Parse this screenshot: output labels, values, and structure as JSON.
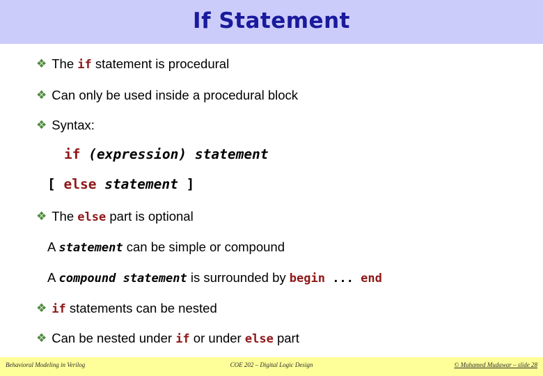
{
  "slide": {
    "title": "If Statement",
    "bullet_glyph": "❖",
    "colors": {
      "header_band": "#ccccfa",
      "title_text": "#1a1a9c",
      "bullet": "#4e8a3c",
      "keyword": "#8f1717",
      "body_text": "#000000",
      "footer_band": "#ffff99",
      "background": "#ffffff"
    }
  },
  "body": {
    "line1": {
      "pre": "The ",
      "kw": "if",
      "post": " statement is procedural"
    },
    "line2": {
      "text": "Can only be used inside a procedural block"
    },
    "line3": {
      "text": "Syntax:"
    },
    "line4": {
      "kw": "if",
      "space": " ",
      "expr": "(expression)",
      "gap": " ",
      "stmt": "statement"
    },
    "line5": {
      "open": "[ ",
      "kw": "else",
      "space": " ",
      "stmt": "statement",
      "close": " ]"
    },
    "line6": {
      "pre": "The ",
      "kw": "else",
      "post": " part is optional"
    },
    "line7": {
      "pre": "A ",
      "stmt": "statement",
      "post": " can be simple or compound"
    },
    "line8": {
      "pre": "A ",
      "stmt": "compound statement",
      "mid": " is surrounded by ",
      "kw_begin": "begin",
      "dots": " ... ",
      "kw_end": "end"
    },
    "line9": {
      "kw": "if",
      "post": " statements can be nested"
    },
    "line10": {
      "pre": "Can be nested under ",
      "kw1": "if",
      "mid": " or under ",
      "kw2": "else",
      "post": " part"
    }
  },
  "footer": {
    "left": "Behavioral Modeling in Verilog",
    "center": "COE 202 – Digital Logic Design",
    "right": "© Muhamed Mudawar – slide 28"
  }
}
